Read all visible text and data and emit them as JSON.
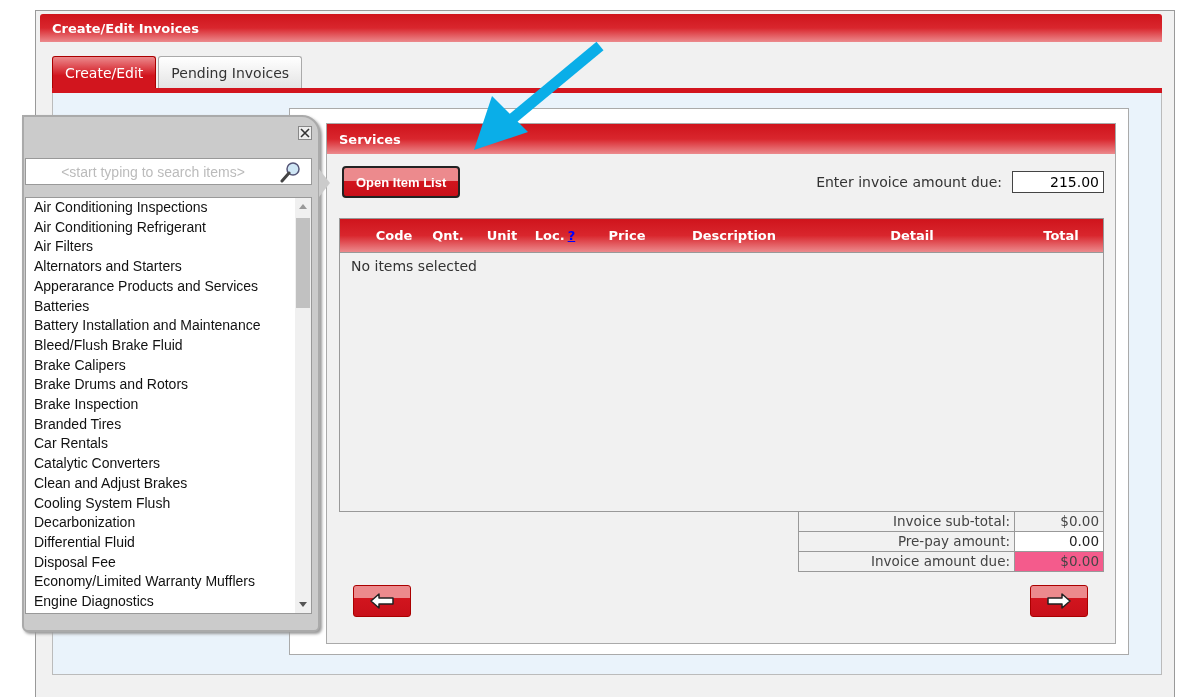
{
  "window": {
    "title": "Create/Edit Invoices"
  },
  "tabs": [
    {
      "label": "Create/Edit",
      "selected": true
    },
    {
      "label": "Pending Invoices",
      "selected": false
    }
  ],
  "services": {
    "title": "Services",
    "open_button": "Open Item List",
    "amount_label": "Enter invoice amount due:",
    "amount_value": "215.00",
    "table": {
      "columns": [
        {
          "label": "Code"
        },
        {
          "label": "Qnt."
        },
        {
          "label": "Unit"
        },
        {
          "label": "Loc.",
          "help": "?"
        },
        {
          "label": "Price"
        },
        {
          "label": "Description"
        },
        {
          "label": "Detail"
        },
        {
          "label": "Total"
        }
      ],
      "empty_text": "No items selected"
    },
    "totals": [
      {
        "label": "Invoice sub-total:",
        "value": "$0.00",
        "kind": "readonly"
      },
      {
        "label": "Pre-pay amount:",
        "value": "0.00",
        "kind": "input"
      },
      {
        "label": "Invoice amount due:",
        "value": "$0.00",
        "kind": "due"
      }
    ]
  },
  "item_picker": {
    "search": {
      "placeholder": "<start typing to search items>"
    },
    "items": [
      "Air Conditioning Inspections",
      "Air Conditioning Refrigerant",
      "Air Filters",
      "Alternators and Starters",
      "Apperarance Products and Services",
      "Batteries",
      "Battery Installation and Maintenance",
      "Bleed/Flush Brake Fluid",
      "Brake Calipers",
      "Brake Drums and Rotors",
      "Brake Inspection",
      "Branded Tires",
      "Car Rentals",
      "Catalytic Converters",
      "Clean and Adjust Brakes",
      "Cooling System Flush",
      "Decarbonization",
      "Differential Fluid",
      "Disposal Fee",
      "Economy/Limited Warranty Mufflers",
      "Engine Diagnostics"
    ]
  }
}
